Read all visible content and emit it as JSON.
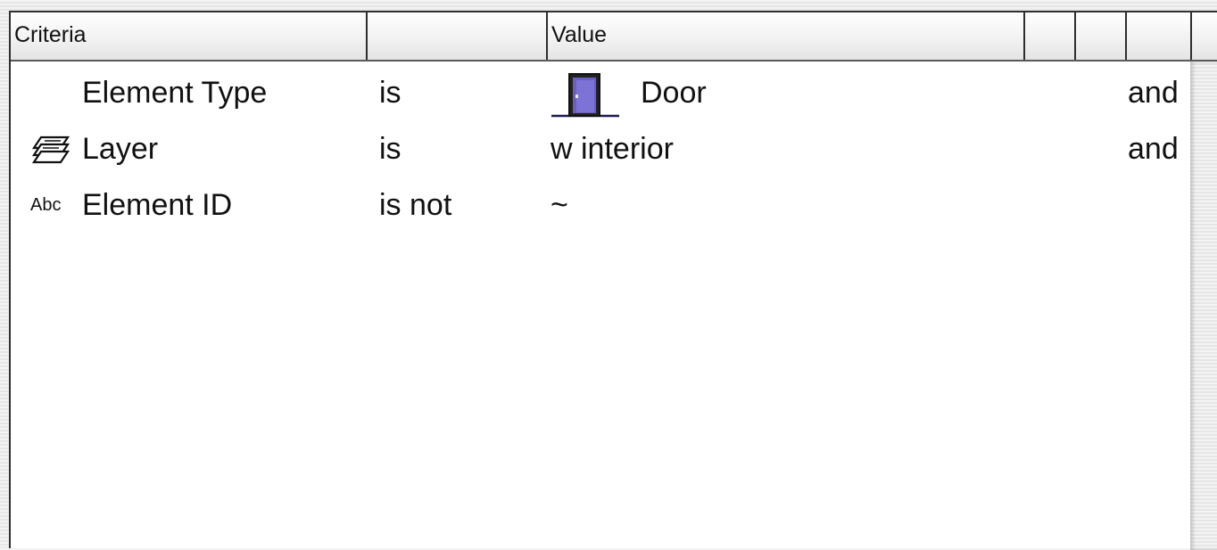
{
  "header": {
    "columns": [
      {
        "label": "Criteria"
      },
      {
        "label": ""
      },
      {
        "label": "Value"
      },
      {
        "label": ""
      },
      {
        "label": ""
      },
      {
        "label": ""
      }
    ]
  },
  "rows": [
    {
      "icon": "none",
      "label": "Element Type",
      "operator": "is",
      "value_icon": "door-icon",
      "value": "Door",
      "conjunction": "and"
    },
    {
      "icon": "layer-icon",
      "label": "Layer",
      "operator": "is",
      "value": "w interior",
      "conjunction": "and"
    },
    {
      "icon": "abc-text-icon",
      "icon_text": "Abc",
      "label": "Element ID",
      "operator": "is not",
      "value": "~",
      "conjunction": ""
    }
  ]
}
